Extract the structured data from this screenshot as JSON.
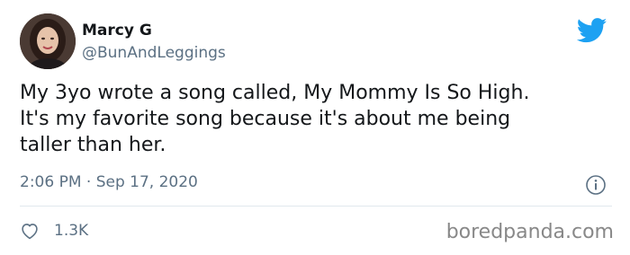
{
  "author": {
    "display_name": "Marcy G",
    "handle": "@BunAndLeggings"
  },
  "tweet": {
    "text": "My 3yo wrote a song called, My Mommy Is So High.\nIt's my favorite song because it's about me being\ntaller than her.",
    "timestamp": "2:06 PM · Sep 17, 2020",
    "likes": "1.3K"
  },
  "watermark": "boredpanda.com",
  "icons": {
    "brand": "twitter-bird-icon",
    "info": "info-icon",
    "like": "heart-icon"
  },
  "colors": {
    "twitter_blue": "#1da1f2",
    "secondary_text": "#5b7083",
    "divider": "#e1e8ed"
  }
}
